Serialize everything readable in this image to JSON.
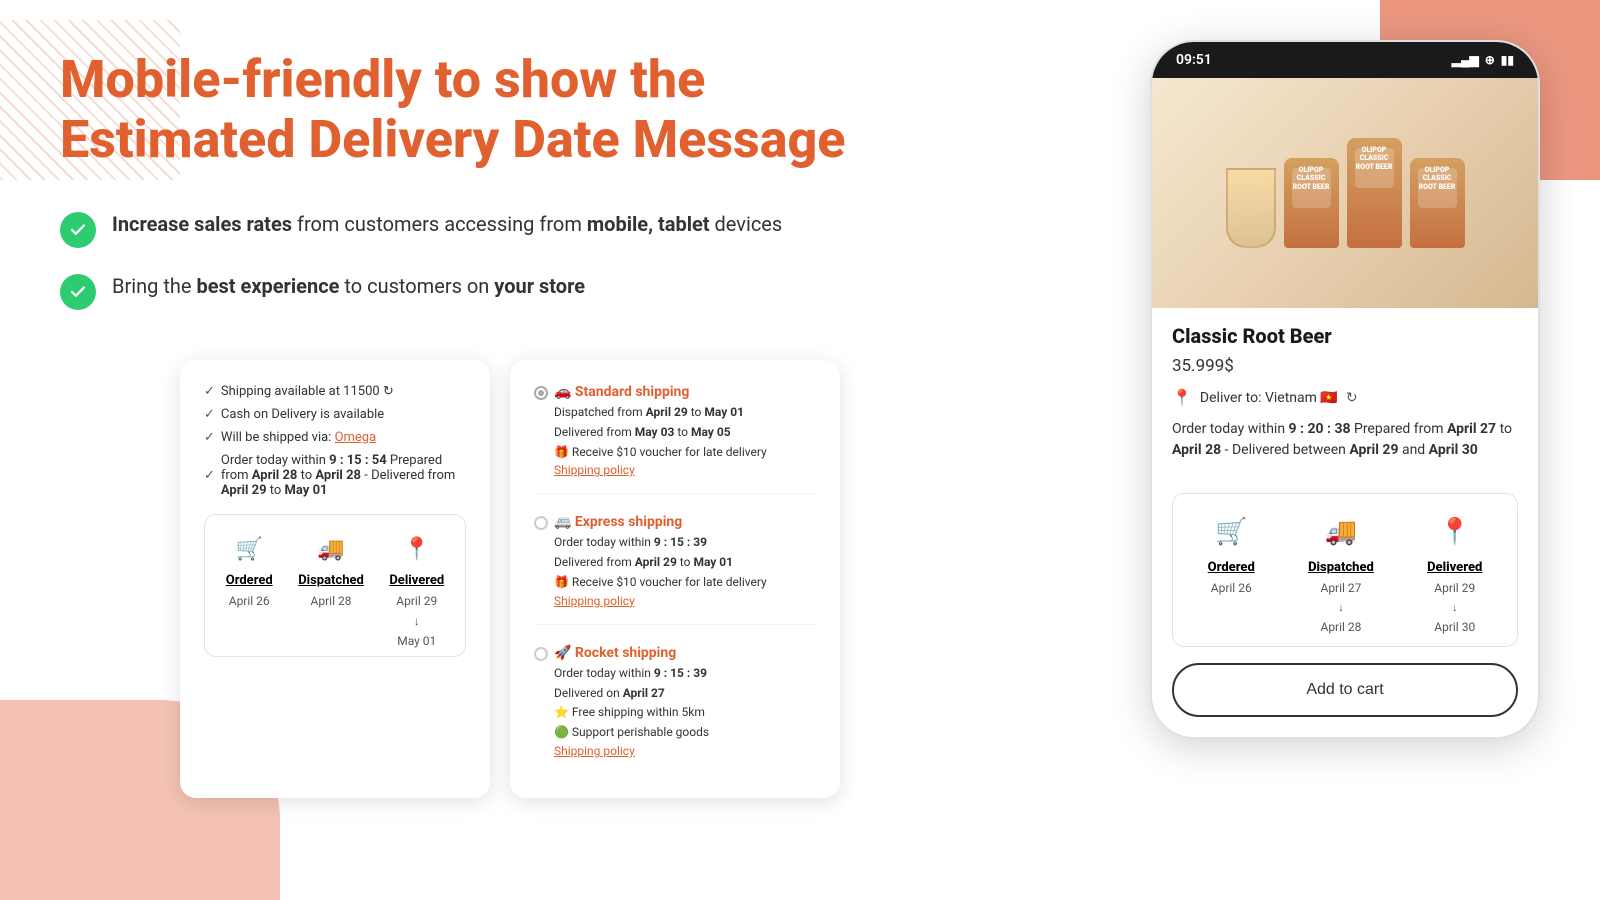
{
  "page": {
    "title": "Mobile-friendly to show the Estimated Delivery Date Message",
    "features": [
      {
        "id": "feature-1",
        "text_parts": [
          {
            "text": "Increase sales rates",
            "bold": true
          },
          {
            "text": " from customers accessing from ",
            "bold": false
          },
          {
            "text": "mobile, tablet",
            "bold": true
          },
          {
            "text": " devices",
            "bold": false
          }
        ],
        "text_display": "Increase sales rates from customers accessing from mobile, tablet devices"
      },
      {
        "id": "feature-2",
        "text_parts": [
          {
            "text": "Bring the ",
            "bold": false
          },
          {
            "text": "best experience",
            "bold": true
          },
          {
            "text": " to customers on ",
            "bold": false
          },
          {
            "text": "your store",
            "bold": true
          }
        ],
        "text_display": "Bring the best experience to customers on your store"
      }
    ]
  },
  "shipping_card": {
    "info_lines": [
      "Shipping available at 11500 ↻",
      "Cash on Delivery is available",
      "Will be shipped via: Omega",
      "Order today within 9 : 15 : 54 Prepared from April 28 to April 28 - Delivered from April 29 to May 01"
    ],
    "link_text": "Omega",
    "progress": {
      "steps": [
        {
          "label": "Ordered",
          "date": "April 26",
          "date2": ""
        },
        {
          "label": "Dispatched",
          "date": "April 28",
          "date2": ""
        },
        {
          "label": "Delivered",
          "date": "April 29",
          "date2": "May 01"
        }
      ]
    }
  },
  "shipping_options": {
    "options": [
      {
        "emoji": "🚗",
        "title": "Standard shipping",
        "detail1": "Dispatched from April 29 to May 01",
        "detail1_bold": [
          "April 29",
          "May 01"
        ],
        "detail2": "Delivered from May 03 to May 05",
        "detail2_bold": [
          "May 03",
          "May 05"
        ],
        "detail3": "🎁 Receive $10 voucher for late delivery",
        "link": "Shipping policy",
        "selected": true
      },
      {
        "emoji": "🚐",
        "title": "Express shipping",
        "detail1": "Order today within 9 : 15 : 39",
        "detail1_bold": [
          "9 : 15 : 39"
        ],
        "detail2": "Delivered from April 29 to May 01",
        "detail2_bold": [
          "April 29",
          "May 01"
        ],
        "detail3": "🎁 Receive $10 voucher for late delivery",
        "link": "Shipping policy",
        "selected": false
      },
      {
        "emoji": "🚀",
        "title": "Rocket shipping",
        "detail1": "Order today within 9 : 15 : 39",
        "detail1_bold": [
          "9 : 15 : 39"
        ],
        "detail2": "Delivered on April 27",
        "detail2_bold": [
          "April 27"
        ],
        "detail3": "⭐ Free shipping within 5km",
        "detail4": "🟢 Support perishable goods",
        "link": "Shipping policy",
        "selected": false
      }
    ]
  },
  "phone": {
    "status_bar": {
      "time": "09:51",
      "icons": "▂▄▆ ⊕ ▮"
    },
    "product": {
      "name": "Classic Root Beer",
      "price": "35.999$",
      "deliver_to": "Deliver to: Vietnam 🇻🇳",
      "order_text_1": "Order today within ",
      "order_time": "9 : 20 : 38",
      "order_text_2": " Prepared from ",
      "order_date1": "April 27",
      "order_text_3": " to ",
      "order_date2": "April 28",
      "order_text_4": " - Delivered between ",
      "order_date3": "April 29",
      "order_text_5": " and ",
      "order_date4": "April 30"
    },
    "progress": {
      "steps": [
        {
          "label": "Ordered",
          "date": "April 26",
          "date2": ""
        },
        {
          "label": "Dispatched",
          "date": "April 27",
          "date2": "April 28"
        },
        {
          "label": "Delivered",
          "date": "April 29",
          "date2": "April 30"
        }
      ]
    },
    "add_to_cart": "Add to cart"
  }
}
